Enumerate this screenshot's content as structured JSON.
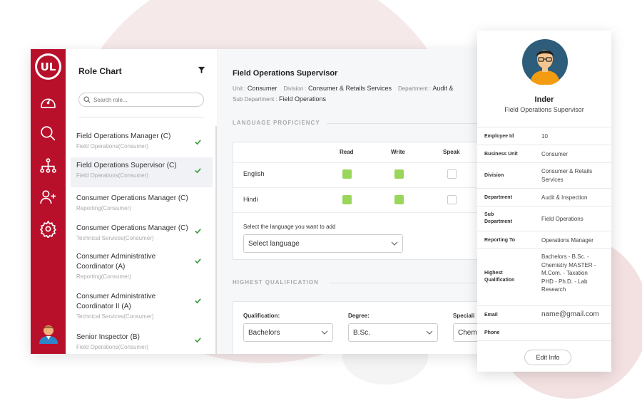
{
  "rail": {
    "logo": "UL",
    "icons": [
      "dashboard-icon",
      "search-icon",
      "hierarchy-icon",
      "add-user-icon",
      "settings-icon"
    ]
  },
  "sidebar": {
    "title": "Role Chart",
    "search_placeholder": "Search role...",
    "roles": [
      {
        "name": "Field Operations Manager (C)",
        "sub": "Field Operations(Consumer)",
        "checked": true,
        "active": false
      },
      {
        "name": "Field Operations Supervisor (C)",
        "sub": "Field Operations(Consumer)",
        "checked": true,
        "active": true
      },
      {
        "name": "Consumer Operations Manager (C)",
        "sub": "Reporting(Consumer)",
        "checked": false,
        "active": false
      },
      {
        "name": "Consumer Operations Manager (C)",
        "sub": "Technical Services(Consumer)",
        "checked": true,
        "active": false
      },
      {
        "name": "Consumer Administrative Coordinator (A)",
        "sub": "Reporting(Consumer)",
        "checked": true,
        "active": false
      },
      {
        "name": "Consumer Administrative Coordinator II (A)",
        "sub": "Technical Services(Consumer)",
        "checked": true,
        "active": false
      },
      {
        "name": "Senior Inspector (B)",
        "sub": "Field Operations(Consumer)",
        "checked": true,
        "active": false
      }
    ]
  },
  "main": {
    "title": "Field Operations Supervisor",
    "unit_label": "Unit :",
    "unit_value": "Consumer",
    "division_label": "Division :",
    "division_value": "Consumer & Retails Services",
    "department_label": "Department :",
    "department_value": "Audit &",
    "subdept_label": "Sub Department :",
    "subdept_value": "Field Operations",
    "language_section": "LANGUAGE PROFICIENCY",
    "columns": [
      "Read",
      "Write",
      "Speak"
    ],
    "languages": [
      {
        "name": "English",
        "read": true,
        "write": true,
        "speak": false
      },
      {
        "name": "Hindi",
        "read": true,
        "write": true,
        "speak": false
      }
    ],
    "add_language_label": "Select the language you want to add",
    "select_language_value": "Select language",
    "qualification_section": "HIGHEST QUALIFICATION",
    "qualification_label": "Qualification:",
    "qualification_value": "Bachelors",
    "degree_label": "Degree:",
    "degree_value": "B.Sc.",
    "specialization_label": "Speciali",
    "specialization_value": "Chem"
  },
  "profile": {
    "name": "Inder",
    "role": "Field Operations Supervisor",
    "fields": [
      {
        "key": "Employee Id",
        "value": "10"
      },
      {
        "key": "Business Unit",
        "value": "Consumer"
      },
      {
        "key": "Division",
        "value": "Consumer & Retails Services"
      },
      {
        "key": "Department",
        "value": "Audit & Inspection"
      },
      {
        "key": "Sub Department",
        "value": "Field Operations"
      },
      {
        "key": "Reporting To",
        "value": "Operations Manager"
      },
      {
        "key": "Highest Qualification",
        "value": "Bachelors - B.Sc. - Chemistry MASTER - M.Com. - Taxation PHD - Ph.D. - Lab Research"
      },
      {
        "key": "Email",
        "value": "name@gmail.com"
      },
      {
        "key": "Phone",
        "value": ""
      }
    ],
    "edit_label": "Edit Info"
  },
  "colors": {
    "brand": "#b8102b",
    "check": "#9bd65c",
    "checkmark": "#3a9a3a"
  }
}
